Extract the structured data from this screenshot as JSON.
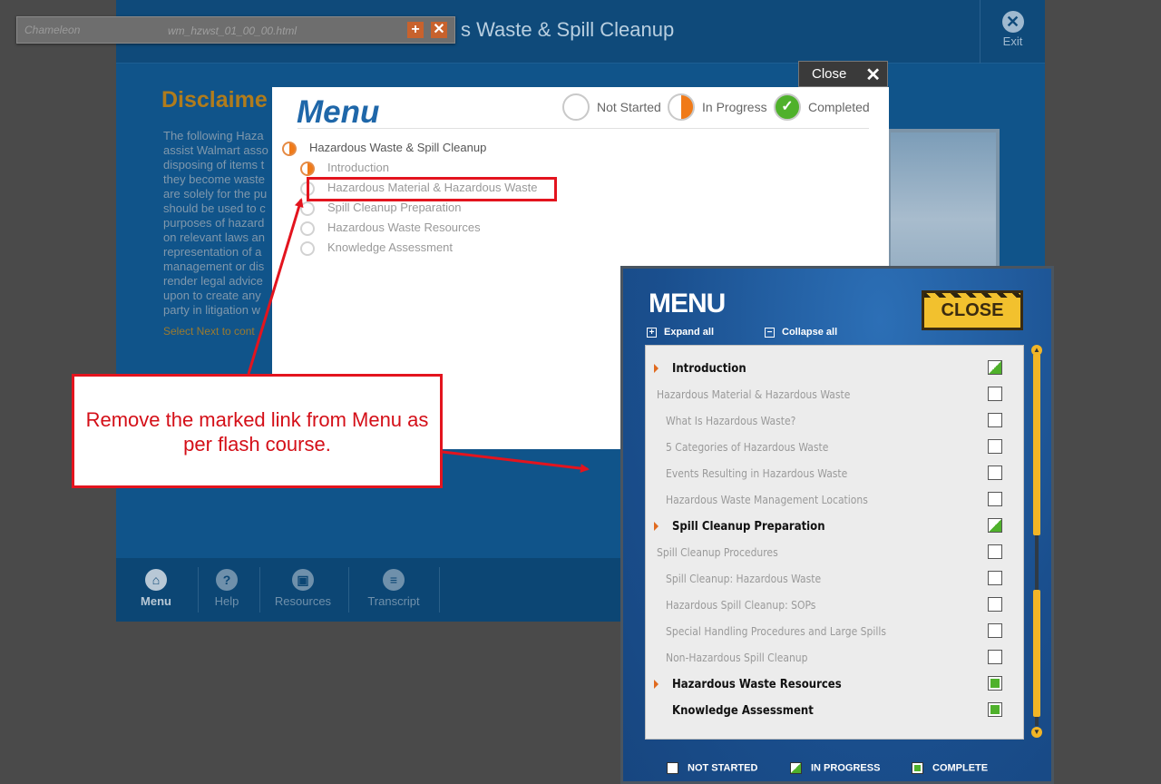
{
  "browser_tab": {
    "logo": "Chameleon",
    "filename": "wm_hzwst_01_00_00.html",
    "add": "+",
    "close": "✕"
  },
  "course": {
    "title": "Hazardous Waste & Spill Cleanup",
    "title_visible": "s Waste & Spill Cleanup",
    "exit_label": "Exit",
    "disclaimer_title": "Disclaime",
    "disclaimer_text": "The following Haza assist Walmart asso disposing of items t they become waste are solely for the pu should be used to c purposes of hazard on relevant laws an representation of a management or dis render legal advice upon to create any party in litigation w",
    "disclaimer_next": "Select Next to cont",
    "nav": [
      {
        "label": "Menu",
        "icon": "⌂"
      },
      {
        "label": "Help",
        "icon": "?"
      },
      {
        "label": "Resources",
        "icon": "▣"
      },
      {
        "label": "Transcript",
        "icon": "≡"
      }
    ]
  },
  "html_menu": {
    "close_label": "Close",
    "close_icon": "✕",
    "title": "Menu",
    "legend": {
      "not_started": "Not Started",
      "in_progress": "In Progress",
      "completed": "Completed",
      "check": "✓"
    },
    "root": "Hazardous Waste & Spill Cleanup",
    "items": [
      "Introduction",
      "Hazardous Material & Hazardous Waste",
      "Spill Cleanup Preparation",
      "Hazardous Waste Resources",
      "Knowledge Assessment"
    ]
  },
  "annotation": {
    "callout": "Remove the marked link from Menu as per flash course.",
    "color": "#e3141e"
  },
  "flash_menu": {
    "title": "MENU",
    "close_label": "CLOSE",
    "expand_all": "Expand all",
    "collapse_all": "Collapse all",
    "expand_icon": "+",
    "collapse_icon": "−",
    "rows": [
      {
        "label": "Introduction",
        "level": "top",
        "status": "in_progress"
      },
      {
        "label": "Hazardous Material & Hazardous Waste",
        "level": "section",
        "status": "not_started"
      },
      {
        "label": "What Is Hazardous Waste?",
        "level": "sub",
        "status": "not_started"
      },
      {
        "label": "5 Categories of Hazardous Waste",
        "level": "sub",
        "status": "not_started"
      },
      {
        "label": "Events Resulting in Hazardous Waste",
        "level": "sub",
        "status": "not_started"
      },
      {
        "label": "Hazardous Waste Management Locations",
        "level": "sub",
        "status": "not_started"
      },
      {
        "label": "Spill Cleanup Preparation",
        "level": "top",
        "status": "in_progress"
      },
      {
        "label": "Spill Cleanup Procedures",
        "level": "section",
        "status": "not_started"
      },
      {
        "label": "Spill Cleanup:  Hazardous Waste",
        "level": "sub",
        "status": "not_started"
      },
      {
        "label": "Hazardous Spill Cleanup:  SOPs",
        "level": "sub",
        "status": "not_started"
      },
      {
        "label": "Special Handling Procedures and Large Spills",
        "level": "sub",
        "status": "not_started"
      },
      {
        "label": "Non-Hazardous Spill Cleanup",
        "level": "sub",
        "status": "not_started"
      },
      {
        "label": "Hazardous Waste Resources",
        "level": "top",
        "status": "complete"
      },
      {
        "label": "Knowledge Assessment",
        "level": "top-noarrow",
        "status": "complete"
      }
    ],
    "legend": {
      "not_started": "NOT STARTED",
      "in_progress": "IN PROGRESS",
      "complete": "COMPLETE"
    },
    "scroll_up": "▲",
    "scroll_down": "▼"
  }
}
